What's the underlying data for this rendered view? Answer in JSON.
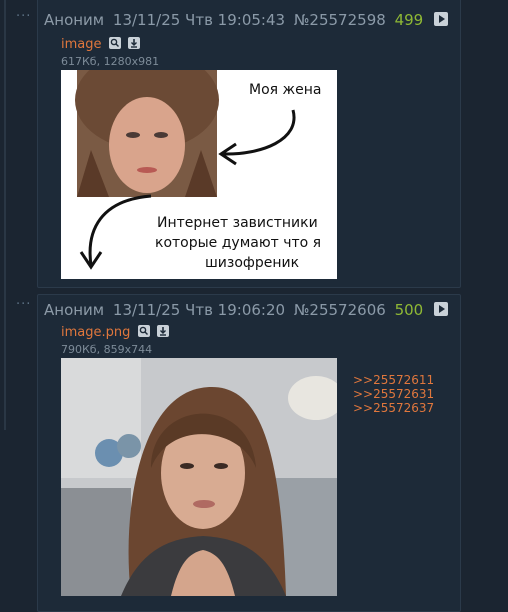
{
  "posts": [
    {
      "author": "Аноним",
      "datetime": "13/11/25 Чтв 19:05:43",
      "number": "№25572598",
      "count": "499",
      "file": {
        "name": "image",
        "info": "617Кб, 1280x981"
      },
      "meme": {
        "caption_top": "Моя жена",
        "caption_bottom": "Интернет завистники которые думают что я шизофреник"
      }
    },
    {
      "author": "Аноним",
      "datetime": "13/11/25 Чтв 19:06:20",
      "number": "№25572606",
      "count": "500",
      "file": {
        "name": "image.png",
        "info": "790Кб, 859x744"
      },
      "replies": [
        ">>25572611",
        ">>25572631",
        ">>25572637"
      ]
    }
  ],
  "colors": {
    "background": "#1b2531",
    "link": "#e0773d",
    "count": "#8fb935"
  }
}
